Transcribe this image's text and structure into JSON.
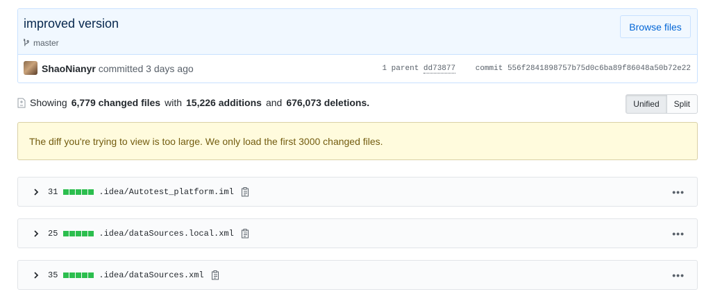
{
  "commit": {
    "title": "improved version",
    "branch": "master",
    "browse_label": "Browse files",
    "author": "ShaoNianyr",
    "action": "committed 3 days ago",
    "parent_label": "1 parent",
    "parent_sha": "dd73877",
    "commit_label": "commit",
    "commit_sha": "556f2841898757b75d0c6ba89f86048a50b72e22"
  },
  "summary": {
    "prefix": "Showing",
    "changed": "6,779 changed files",
    "with": "with",
    "additions": "15,226 additions",
    "and": "and",
    "deletions": "676,073 deletions."
  },
  "view_toggle": {
    "unified": "Unified",
    "split": "Split",
    "selected": "Unified"
  },
  "flash_message": "The diff you're trying to view is too large. We only load the first 3000 changed files.",
  "files": [
    {
      "count": "31",
      "name": ".idea/Autotest_platform.iml",
      "additions_blocks": 5
    },
    {
      "count": "25",
      "name": ".idea/dataSources.local.xml",
      "additions_blocks": 5
    },
    {
      "count": "35",
      "name": ".idea/dataSources.xml",
      "additions_blocks": 5
    }
  ],
  "colors": {
    "addition": "#2cbe4e",
    "link": "#0366d6",
    "flash_bg": "#fffbdd"
  }
}
